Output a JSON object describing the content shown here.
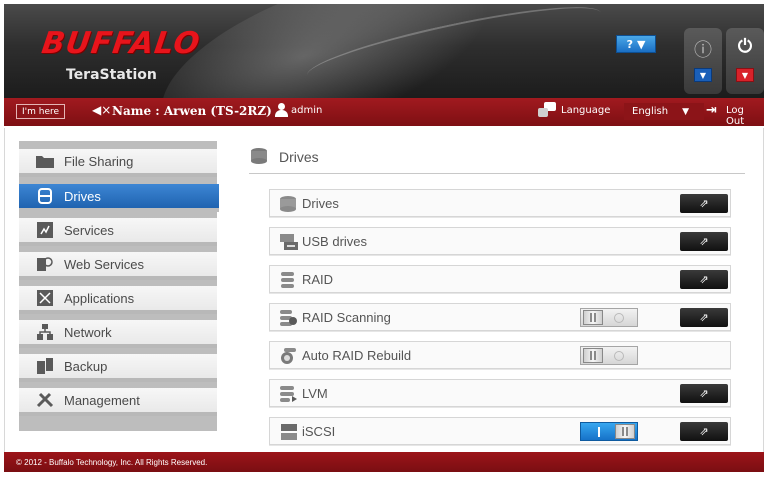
{
  "header": {
    "brand": "BUFFALO",
    "product": "TeraStation",
    "help_label": "?"
  },
  "infobar": {
    "im_here": "I'm here",
    "name_label": "Name : Arwen (TS-2RZ)",
    "user": "admin",
    "language_label": "Language",
    "language_value": "English",
    "logout_label": "Log Out"
  },
  "sidebar": {
    "items": [
      {
        "label": "File Sharing",
        "icon": "folder-icon",
        "active": false
      },
      {
        "label": "Drives",
        "icon": "drives-icon",
        "active": true
      },
      {
        "label": "Services",
        "icon": "services-icon",
        "active": false
      },
      {
        "label": "Web Services",
        "icon": "web-services-icon",
        "active": false
      },
      {
        "label": "Applications",
        "icon": "applications-icon",
        "active": false
      },
      {
        "label": "Network",
        "icon": "network-icon",
        "active": false
      },
      {
        "label": "Backup",
        "icon": "backup-icon",
        "active": false
      },
      {
        "label": "Management",
        "icon": "management-icon",
        "active": false
      }
    ]
  },
  "content": {
    "title": "Drives",
    "rows": [
      {
        "label": "Drives",
        "icon": "disk-icon",
        "toggle": null,
        "has_open": true
      },
      {
        "label": "USB drives",
        "icon": "usb-drive-icon",
        "toggle": null,
        "has_open": true
      },
      {
        "label": "RAID",
        "icon": "raid-icon",
        "toggle": null,
        "has_open": true
      },
      {
        "label": "RAID Scanning",
        "icon": "raid-scanning-icon",
        "toggle": "off",
        "has_open": true
      },
      {
        "label": "Auto RAID Rebuild",
        "icon": "auto-rebuild-icon",
        "toggle": "off",
        "has_open": false
      },
      {
        "label": "LVM",
        "icon": "lvm-icon",
        "toggle": null,
        "has_open": true
      },
      {
        "label": "iSCSI",
        "icon": "iscsi-icon",
        "toggle": "on",
        "has_open": true
      }
    ]
  },
  "footer": {
    "copyright": "© 2012 - Buffalo Technology, Inc. All Rights Reserved."
  },
  "colors": {
    "brand_red": "#e8141b",
    "bar_red": "#8c1418",
    "active_blue": "#2a74c4",
    "toggle_on_blue": "#1e8ad8"
  }
}
